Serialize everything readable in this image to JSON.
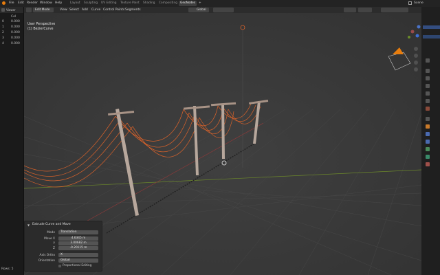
{
  "top_menu": {
    "file": "File",
    "edit": "Edit",
    "render": "Render",
    "window": "Window",
    "help": "Help",
    "workspaces": [
      "Layout",
      "Sculpting",
      "UV Editing",
      "Texture Paint",
      "Shading",
      "Compositing",
      "GeoNodes"
    ],
    "active_workspace": "GeoNodes",
    "add_tab": "+",
    "scene": "Scene"
  },
  "spreadsheet": {
    "editor_label": "Viewer",
    "column_header": "Col",
    "rows": [
      {
        "index": "0",
        "value": "0.000"
      },
      {
        "index": "1",
        "value": "0.000"
      },
      {
        "index": "2",
        "value": "0.000"
      },
      {
        "index": "3",
        "value": "0.000"
      },
      {
        "index": "4",
        "value": "0.000"
      }
    ],
    "rows_label": "Rows: 5"
  },
  "viewport_header": {
    "mode": "Edit Mode",
    "menus": [
      "View",
      "Select",
      "Add",
      "Curve",
      "Control Points",
      "Segments"
    ],
    "orientation": "Global"
  },
  "viewport": {
    "perspective": "User Perspective",
    "object": "(1) BezierCurve"
  },
  "operator_panel": {
    "title": "Extrude Curve and Move",
    "mode_label": "Mode",
    "mode_value": "Translation",
    "move_x_label": "Move X",
    "move_x": "4.6345 m",
    "y_label": "Y",
    "move_y": "3.00682 m",
    "z_label": "Z",
    "move_z": "-0.20115 m",
    "axis_ortho_label": "Axis Ortho",
    "axis_ortho": "X",
    "orientation_label": "Orientation",
    "orientation": "Global",
    "proportional_label": "Proportional Editing"
  },
  "colors": {
    "accent": "#e87d0d",
    "wire": "#d9622a",
    "axis_x": "#8a3a3a",
    "axis_y": "#6d8a2a"
  }
}
